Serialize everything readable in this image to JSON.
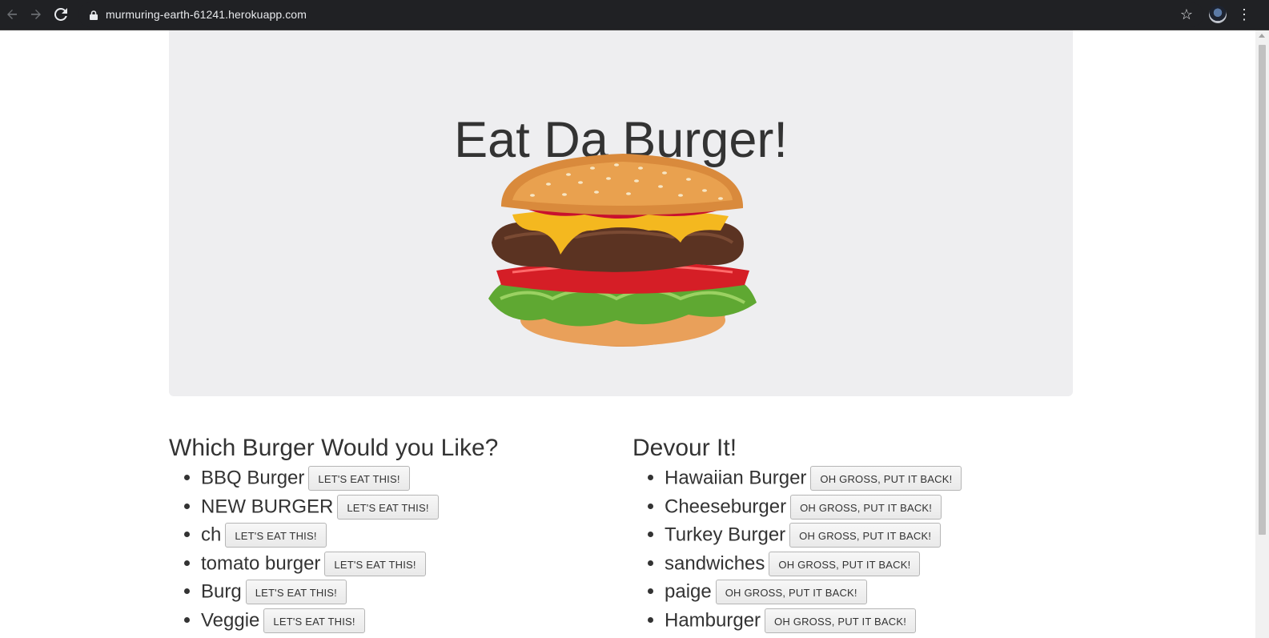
{
  "browser": {
    "url": "murmuring-earth-61241.herokuapp.com"
  },
  "page": {
    "title": "Eat Da Burger!",
    "image_alt": "hamburger photo"
  },
  "left_column": {
    "heading": "Which Burger Would you Like?",
    "button_label": "LET'S EAT THIS!",
    "items": [
      {
        "name": "BBQ Burger",
        "button": "LET'S EAT THIS!"
      },
      {
        "name": "NEW BURGER",
        "button": "LET'S EAT THIS!"
      },
      {
        "name": "ch",
        "button": "LET'S EAT THIS!"
      },
      {
        "name": "tomato burger",
        "button": "LET'S EAT THIS!"
      },
      {
        "name": "Burg",
        "button": "LET'S EAT THIS!"
      },
      {
        "name": "Veggie",
        "button": "LET'S EAT THIS!"
      }
    ]
  },
  "right_column": {
    "heading": "Devour It!",
    "items": [
      {
        "name": "Hawaiian Burger",
        "button": "OH GROSS, PUT IT BACK!"
      },
      {
        "name": "Cheeseburger",
        "button": "OH GROSS, PUT IT BACK!"
      },
      {
        "name": "Turkey Burger",
        "button": "OH GROSS, PUT IT BACK!"
      },
      {
        "name": "sandwiches",
        "button": "OH GROSS, PUT IT BACK!"
      },
      {
        "name": "paige",
        "button": "OH GROSS, PUT IT BACK!"
      },
      {
        "name": "Hamburger",
        "button": "OH GROSS, PUT IT BACK!"
      }
    ]
  },
  "colors": {
    "jumbotron_bg": "#eeeef0",
    "chrome_bg": "#202124",
    "text": "#333333"
  }
}
